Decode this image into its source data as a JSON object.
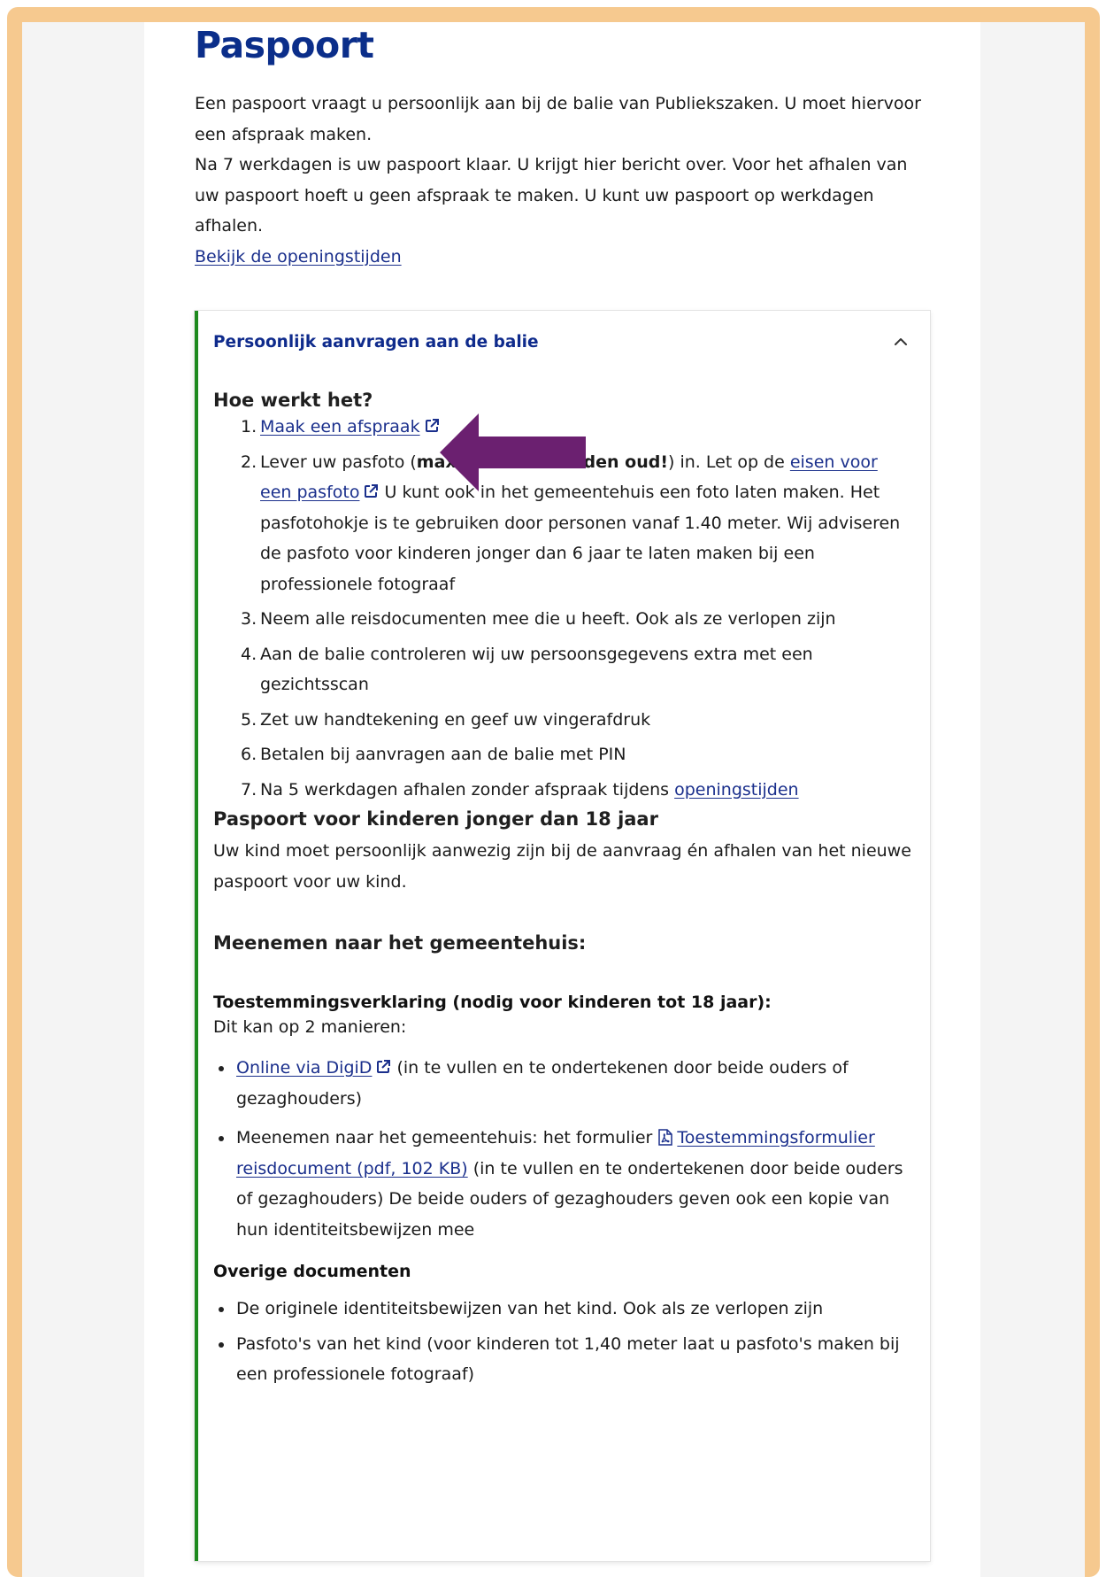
{
  "page": {
    "title": "Paspoort",
    "intro_line1": "Een paspoort vraagt u persoonlijk aan bij de balie van Publiekszaken. U moet hiervoor een afspraak maken.",
    "intro_line2": "Na 7 werkdagen is uw paspoort klaar. U krijgt hier bericht over. Voor het afhalen van uw paspoort hoeft u geen afspraak te maken. U kunt uw paspoort op werkdagen afhalen.",
    "openingstijden_link": "Bekijk de openingstijden"
  },
  "accordion": {
    "title": "Persoonlijk aanvragen aan de balie",
    "state": "expanded",
    "how_heading": "Hoe werkt het?",
    "steps": [
      {
        "num": "1.",
        "link": "Maak een afspraak"
      },
      {
        "num": "2.",
        "pre": "Lever uw pasfoto (",
        "bold": "maximaal 6 maanden oud!",
        "mid": ") in. Let op de ",
        "link": "eisen voor een pasfoto",
        "post": " U kunt ook in het gemeentehuis een foto laten maken. Het pasfotohokje is te gebruiken door personen vanaf 1.40 meter. Wij adviseren de pasfoto voor kinderen jonger dan 6 jaar te laten maken bij een professionele fotograaf"
      },
      {
        "num": "3.",
        "text": "Neem alle reisdocumenten mee die u heeft. Ook als ze verlopen zijn"
      },
      {
        "num": "4.",
        "text": "Aan de balie controleren wij uw persoonsgegevens extra met een gezichtsscan"
      },
      {
        "num": "5.",
        "text": "Zet uw handtekening en geef uw vingerafdruk"
      },
      {
        "num": "6.",
        "text": "Betalen bij aanvragen aan de balie met PIN"
      },
      {
        "num": "7.",
        "pre": "Na 5 werkdagen afhalen zonder afspraak tijdens ",
        "link": "openingstijden"
      }
    ],
    "kids_heading": "Paspoort voor kinderen jonger dan 18 jaar",
    "kids_text": "Uw kind moet persoonlijk aanwezig zijn bij de aanvraag én afhalen van het nieuwe paspoort voor uw kind.",
    "bring_heading": "Meenemen naar het gemeentehuis:",
    "consent_heading": "Toestemmingsverklaring (nodig voor kinderen tot 18 jaar):",
    "consent_intro": "Dit kan op 2 manieren:",
    "consent_items": [
      {
        "link": "Online via DigiD",
        "post": " (in te vullen en te ondertekenen door beide ouders of gezaghouders)"
      },
      {
        "pre": "Meenemen naar het gemeentehuis: het formulier ",
        "link": "Toestemmingsformulier reisdocument (pdf, 102 KB)",
        "post": " (in te vullen en te ondertekenen door beide ouders of gezaghouders) De beide ouders of gezaghouders geven ook een kopie van hun identiteitsbewijzen mee"
      }
    ],
    "other_heading": "Overige documenten",
    "other_items": [
      "De originele identiteitsbewijzen van het kind. Ook als ze verlopen zijn",
      "Pasfoto's van het kind (voor kinderen tot 1,40 meter laat u pasfoto's maken bij een professionele fotograaf)"
    ]
  },
  "colors": {
    "frame": "#f6c98f",
    "heading_blue": "#0b2e8a",
    "link": "#1a2f8c",
    "accent_border": "#1e8a1e",
    "arrow": "#6b2070"
  },
  "icons": {
    "external": "external-link-icon",
    "pdf": "pdf-icon",
    "chevron": "chevron-up-icon",
    "annotation": "arrow-left-icon"
  }
}
